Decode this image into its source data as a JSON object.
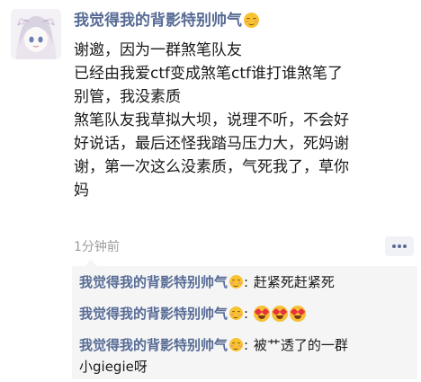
{
  "post": {
    "author": "我觉得我的背影特别帅气",
    "author_emoji": "smiling-blush-emoji",
    "body_lines": [
      "谢邀，因为一群煞笔队友",
      "已经由我爱ctf变成煞笔ctf谁打谁煞笔了",
      "别管，我没素质",
      "煞笔队友我草拟大坝，说理不听，不会好",
      "好说话，最后还怪我踏马压力大，死妈谢",
      "谢，第一次这么没素质，气死我了，草你",
      "妈"
    ],
    "time": "1分钟前"
  },
  "comments": [
    {
      "author": "我觉得我的背影特别帅气",
      "separator": ":",
      "text": "赶紧死赶紧死"
    },
    {
      "author": "我觉得我的背影特别帅气",
      "separator": ":",
      "emojis": [
        "heart-eyes-emoji",
        "heart-eyes-emoji",
        "heart-eyes-emoji"
      ]
    },
    {
      "author": "我觉得我的背影特别帅气",
      "separator": ":",
      "text_line1": "被艹透了的一群",
      "text_line2": "小giegie呀"
    }
  ],
  "colors": {
    "author_link": "#576b95",
    "comment_bg": "#f5f5f5",
    "time_gray": "#9b9b9b"
  }
}
